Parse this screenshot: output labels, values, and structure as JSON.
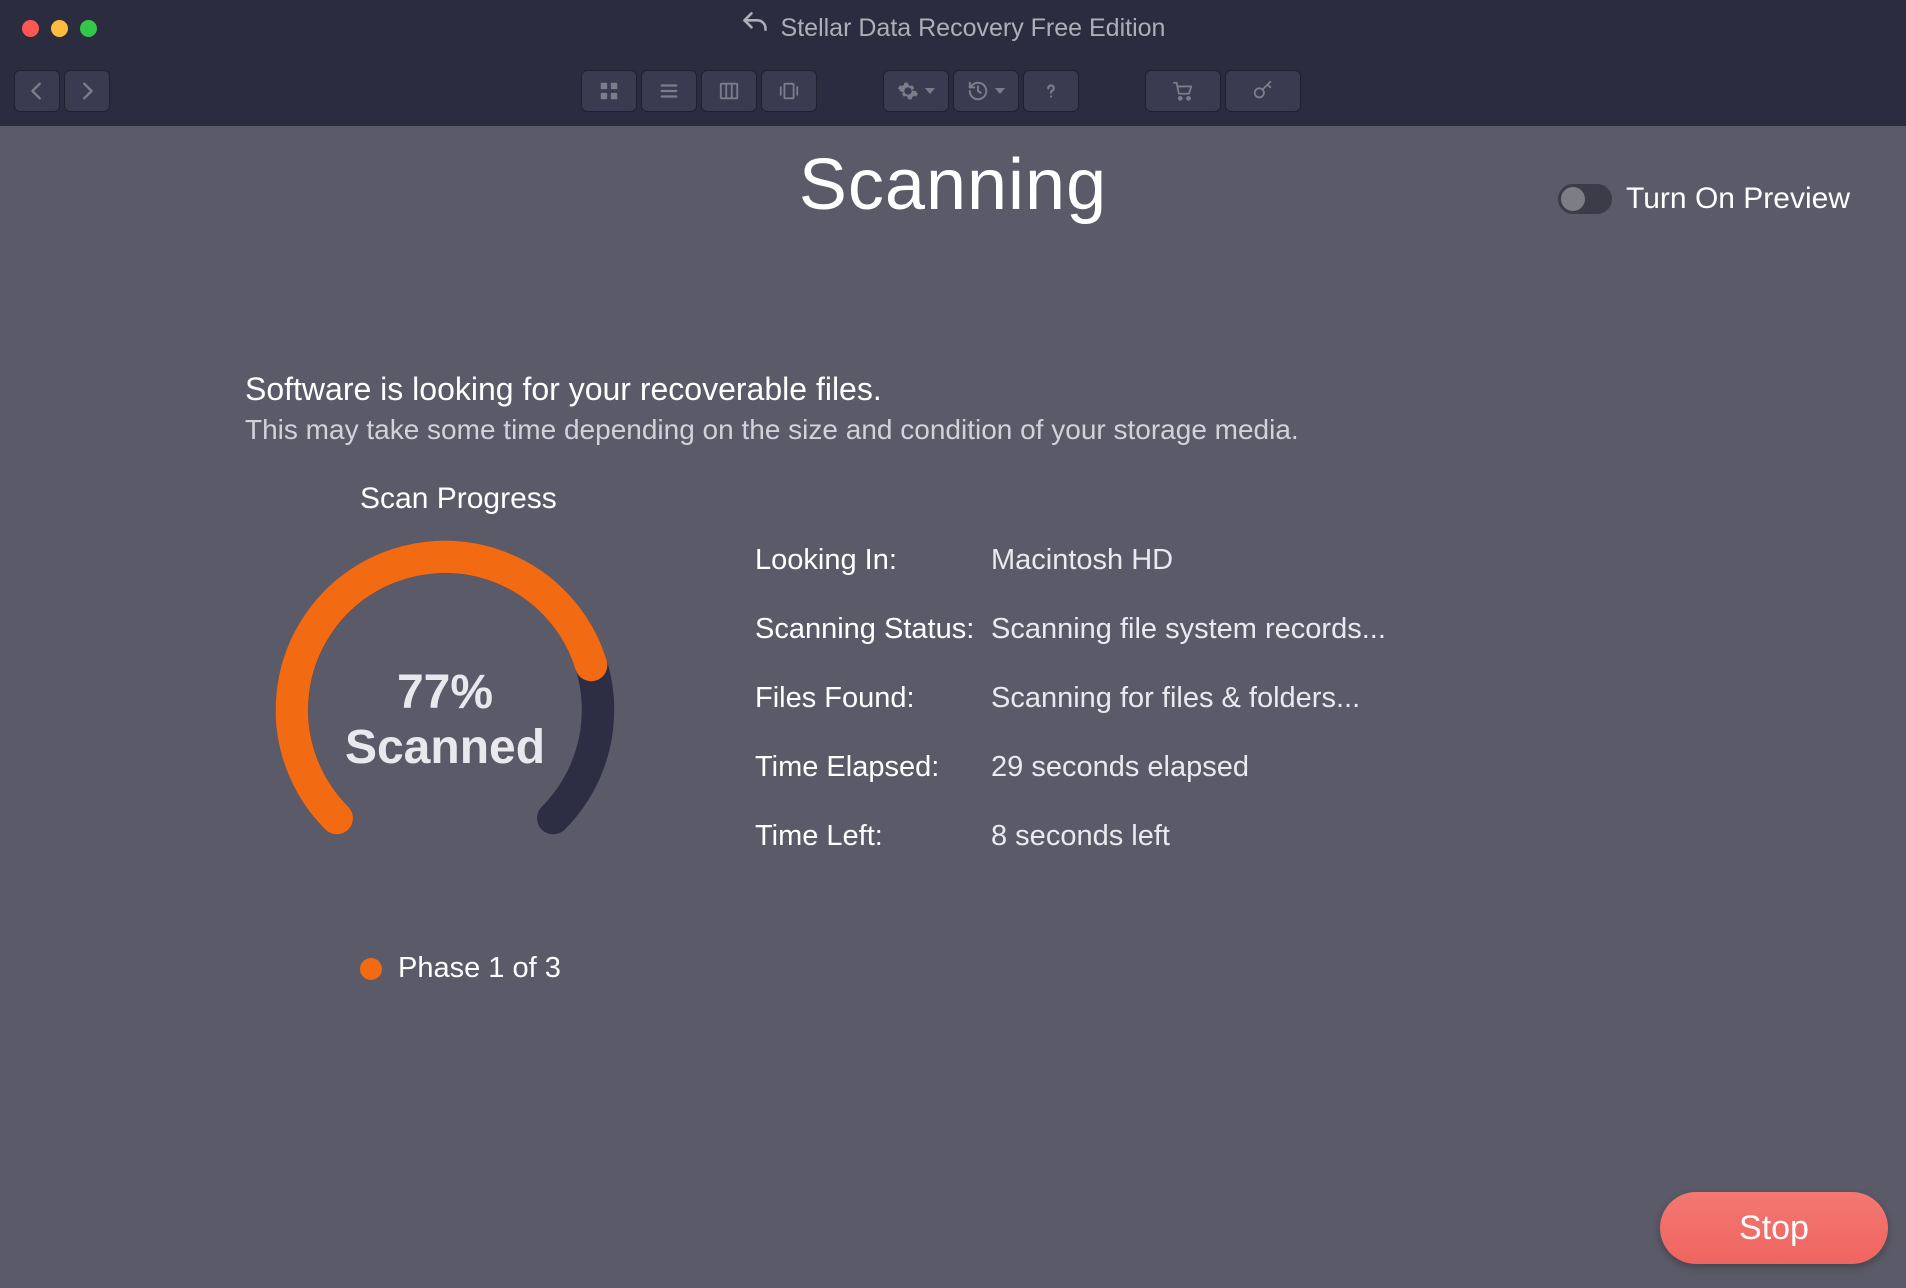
{
  "window": {
    "title": "Stellar Data Recovery Free Edition"
  },
  "toolbar": {
    "back": "Back",
    "forward": "Forward",
    "view_grid": "Grid View",
    "view_list": "List View",
    "view_columns": "Column View",
    "view_gallery": "Gallery View",
    "settings": "Settings",
    "history": "History",
    "help": "Help",
    "buy": "Buy",
    "activate": "Activate"
  },
  "page": {
    "title": "Scanning",
    "preview_label": "Turn On Preview",
    "preview_on": false
  },
  "info": {
    "headline": "Software is looking for your recoverable files.",
    "sub": "This may take some time depending on the size and condition of your storage media."
  },
  "progress": {
    "label": "Scan Progress",
    "percent": 77,
    "percent_text": "77%",
    "scanned_word": "Scanned",
    "phase_text": "Phase 1 of 3",
    "accent_color": "#f26a11",
    "track_color": "#2d2d44"
  },
  "details": {
    "rows": [
      {
        "key": "Looking In:",
        "val": "Macintosh HD"
      },
      {
        "key": "Scanning Status:",
        "val": "Scanning file system records..."
      },
      {
        "key": "Files Found:",
        "val": "Scanning for files & folders..."
      },
      {
        "key": "Time Elapsed:",
        "val": "29 seconds elapsed"
      },
      {
        "key": "Time Left:",
        "val": "8 seconds left"
      }
    ]
  },
  "actions": {
    "stop": "Stop"
  }
}
